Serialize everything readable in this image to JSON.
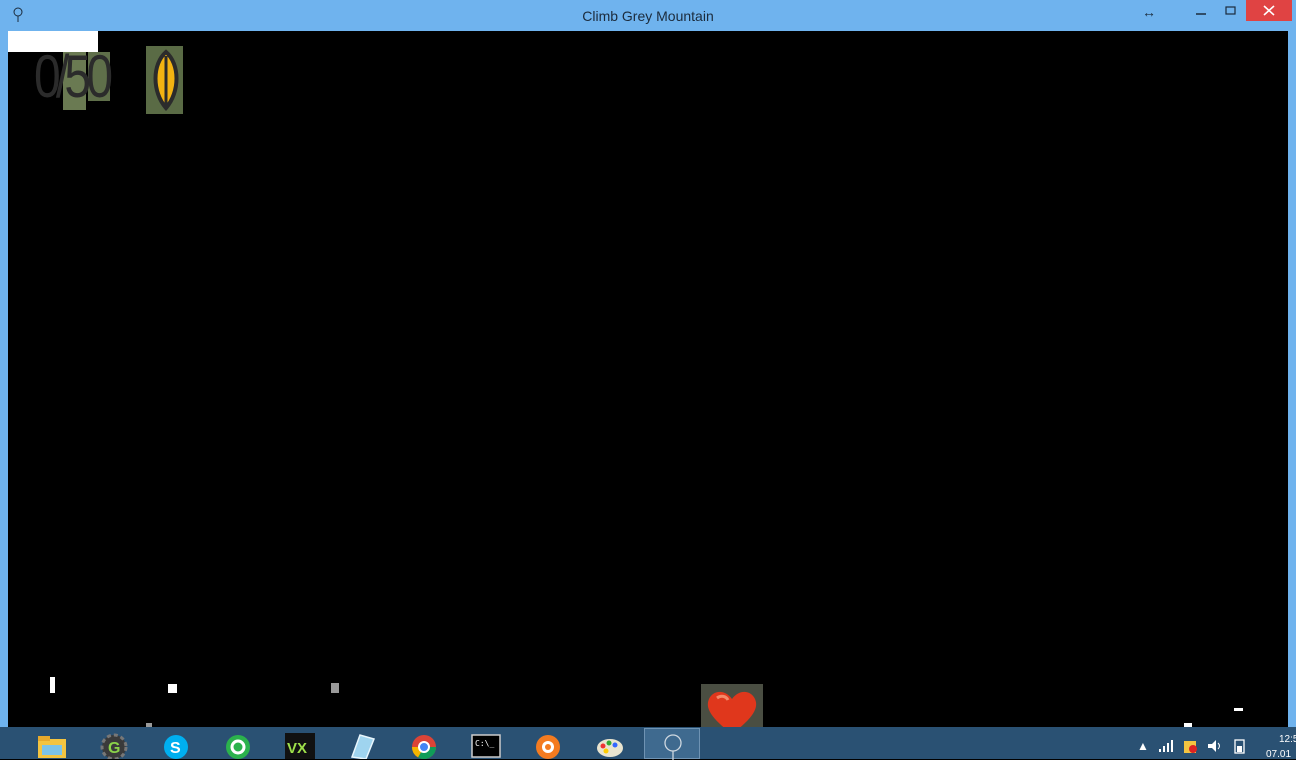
{
  "window": {
    "title": "Climb Grey Mountain"
  },
  "hud": {
    "counter": "0/50"
  },
  "taskbar": {
    "items": [
      {
        "icon": "folder-icon"
      },
      {
        "icon": "gear-g-icon"
      },
      {
        "icon": "skype-icon"
      },
      {
        "icon": "green-circle-icon"
      },
      {
        "icon": "vx-icon"
      },
      {
        "icon": "notepad-icon"
      },
      {
        "icon": "chrome-icon"
      },
      {
        "icon": "terminal-icon"
      },
      {
        "icon": "orange-circle-icon"
      },
      {
        "icon": "paint-icon"
      },
      {
        "icon": "tree-icon"
      }
    ],
    "clock_time": "12:5",
    "clock_date": "07.01"
  },
  "colors": {
    "titlebar": "#6fb3ee",
    "taskbar": "#2a5173",
    "close": "#e04343",
    "heart": "#e0371c",
    "leaf": "#f2b312"
  }
}
